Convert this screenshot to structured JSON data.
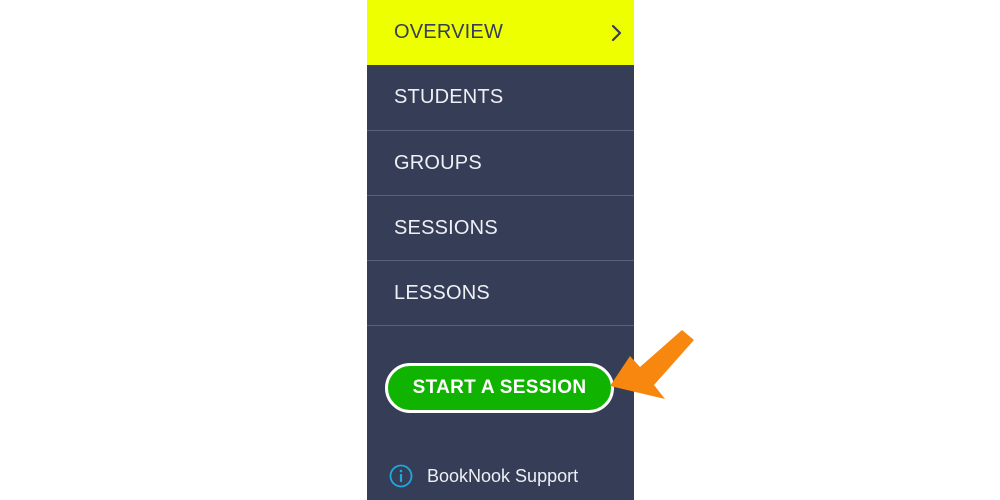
{
  "nav": {
    "items": [
      {
        "label": "OVERVIEW"
      },
      {
        "label": "STUDENTS"
      },
      {
        "label": "GROUPS"
      },
      {
        "label": "SESSIONS"
      },
      {
        "label": "LESSONS"
      }
    ]
  },
  "cta": {
    "label": "START A SESSION"
  },
  "support": {
    "label": "BookNook Support",
    "icon": "info-icon"
  },
  "annotation": {
    "icon": "pointer-arrow-icon",
    "color": "#f7870e"
  },
  "colors": {
    "sidebar_bg": "#363d56",
    "active_bg": "#eeff00",
    "cta_bg": "#10b400",
    "info_icon": "#1fa8e0"
  }
}
